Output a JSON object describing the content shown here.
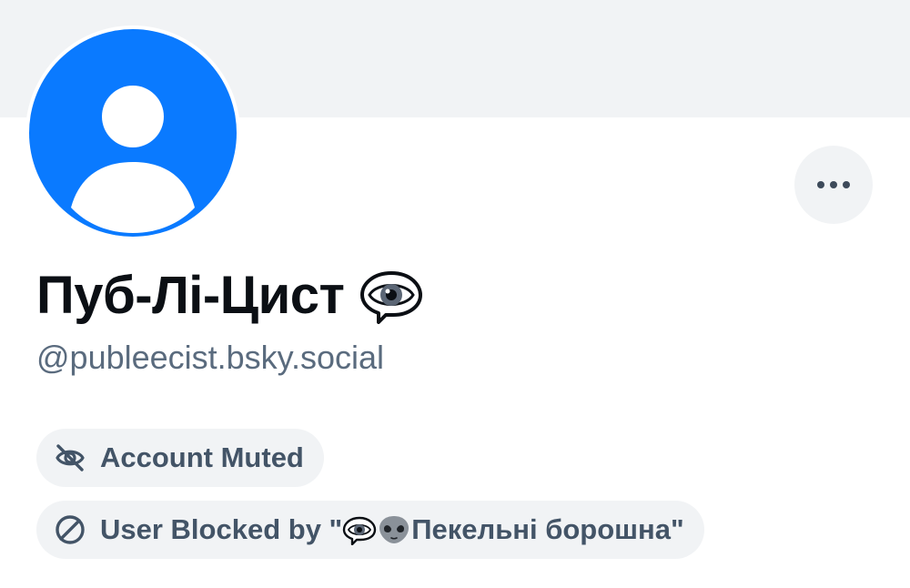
{
  "profile": {
    "display_name": "Пуб-Лі-Цист",
    "display_name_emoji": "eye-in-speech-bubble-icon",
    "handle": "@publeecist.bsky.social",
    "avatar": "default-user-avatar-icon",
    "more_menu_icon": "ellipsis-icon"
  },
  "moderation": {
    "muted": {
      "icon": "eye-slash-icon",
      "label": "Account Muted"
    },
    "blocked": {
      "icon": "block-circle-icon",
      "label_prefix": "User Blocked by \"",
      "list_emoji_1": "eye-in-speech-bubble-icon",
      "list_emoji_2": "alien-icon",
      "list_name": " Пекельні борошна",
      "label_suffix": "\""
    }
  },
  "colors": {
    "avatar_blue": "#0a7aff",
    "banner": "#f1f3f5",
    "pill_bg": "#f1f3f5",
    "pill_text": "#435467",
    "handle_text": "#5a6b7e",
    "name_text": "#0b0f14"
  }
}
